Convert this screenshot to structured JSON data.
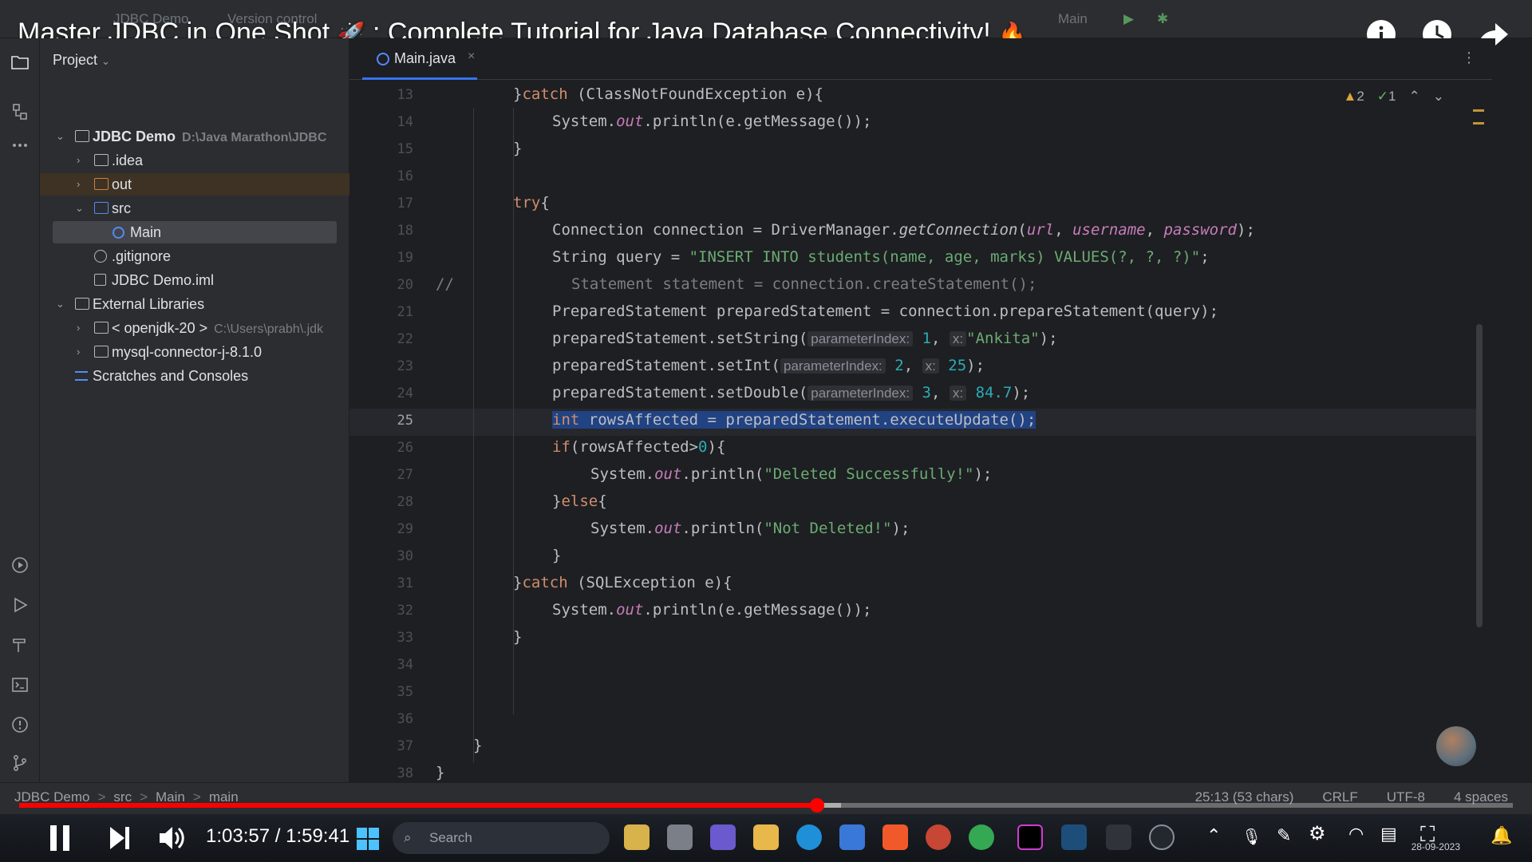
{
  "video": {
    "title": "Master JDBC in One Shot",
    "title_rest": ": Complete Tutorial for Java Database Connectivity!",
    "rocket_icon": "🚀",
    "fire_icon": "🔥",
    "time_current": "1:03:57",
    "time_total": "1:59:41",
    "progress_fraction": 0.534,
    "buffered_fraction": 0.55,
    "accent_color": "#ff0000"
  },
  "ide": {
    "project_name": "JDBC Demo",
    "version_control": "Version control",
    "run_config": "Main",
    "project_label": "Project",
    "tab_file": "Main.java",
    "inspections": {
      "warnings": "2",
      "checks": "1"
    }
  },
  "project_tree": [
    {
      "label": "JDBC Demo",
      "hint": "D:\\Java Marathon\\JDBC",
      "bold": true
    },
    {
      "label": ".idea"
    },
    {
      "label": "out"
    },
    {
      "label": "src"
    },
    {
      "label": "Main"
    },
    {
      "label": ".gitignore"
    },
    {
      "label": "JDBC Demo.iml"
    },
    {
      "label": "External Libraries"
    },
    {
      "label": "< openjdk-20 >",
      "hint": "C:\\Users\\prabh\\.jdk"
    },
    {
      "label": "mysql-connector-j-8.1.0"
    },
    {
      "label": "Scratches and Consoles"
    }
  ],
  "line_numbers": [
    "13",
    "14",
    "15",
    "16",
    "17",
    "18",
    "19",
    "20",
    "21",
    "22",
    "23",
    "24",
    "25",
    "26",
    "27",
    "28",
    "29",
    "30",
    "31",
    "32",
    "33",
    "34",
    "35",
    "36",
    "37",
    "38"
  ],
  "current_line": "25",
  "code": {
    "l13_a": "}",
    "l13_kw": "catch",
    "l13_b": " (ClassNotFoundException e){",
    "l14_a": "System.",
    "l14_f": "out",
    "l14_b": ".println(e.getMessage());",
    "l15": "}",
    "l17_kw": "try",
    "l17_b": "{",
    "l18_a": "Connection connection = DriverManager.",
    "l18_m": "getConnection",
    "l18_p": "(",
    "l18_f1": "url",
    "l18_c1": ", ",
    "l18_f2": "username",
    "l18_c2": ", ",
    "l18_f3": "password",
    "l18_e": ");",
    "l19_a": "String query = ",
    "l19_s": "\"INSERT INTO students(name, age, marks) VALUES(?, ?, ?)\"",
    "l19_e": ";",
    "l20_c": "//",
    "l20_b": "Statement statement = connection.createStatement();",
    "l21": "PreparedStatement preparedStatement = connection.prepareStatement(query);",
    "l22_a": "preparedStatement.setString(",
    "l22_h1": "parameterIndex:",
    "l22_n": "1",
    "l22_c": ", ",
    "l22_h2": "x:",
    "l22_s": "\"Ankita\"",
    "l22_e": ");",
    "l23_a": "preparedStatement.setInt(",
    "l23_h1": "parameterIndex:",
    "l23_n": "2",
    "l23_c": ", ",
    "l23_h2": "x:",
    "l23_v": "25",
    "l23_e": ");",
    "l24_a": "preparedStatement.setDouble(",
    "l24_h1": "parameterIndex:",
    "l24_n": "3",
    "l24_c": ", ",
    "l24_h2": "x:",
    "l24_v": "84.7",
    "l24_e": ");",
    "l25_kw": "int",
    "l25_b": " rowsAffected = preparedStatement.executeUpdate();",
    "l26_kw": "if",
    "l26_a": "(rowsAffected>",
    "l26_n": "0",
    "l26_b": "){",
    "l27_a": "System.",
    "l27_f": "out",
    "l27_b": ".println(",
    "l27_s": "\"Deleted Successfully!\"",
    "l27_e": ");",
    "l28_a": "}",
    "l28_kw": "else",
    "l28_b": "{",
    "l29_a": "System.",
    "l29_f": "out",
    "l29_b": ".println(",
    "l29_s": "\"Not Deleted!\"",
    "l29_e": ");",
    "l30": "}",
    "l31_a": "}",
    "l31_kw": "catch",
    "l31_b": " (SQLException e){",
    "l32_a": "System.",
    "l32_f": "out",
    "l32_b": ".println(e.getMessage());",
    "l33": "}",
    "l37": "}",
    "l38": "}"
  },
  "statusbar": {
    "crumbs": [
      "JDBC Demo",
      "src",
      "Main",
      "main"
    ],
    "sep": ">",
    "position": "25:13 (53 chars)",
    "line_ending": "CRLF",
    "encoding": "UTF-8",
    "indent": "4 spaces"
  },
  "taskbar": {
    "search_placeholder": "Search",
    "date": "28-09-2023"
  }
}
